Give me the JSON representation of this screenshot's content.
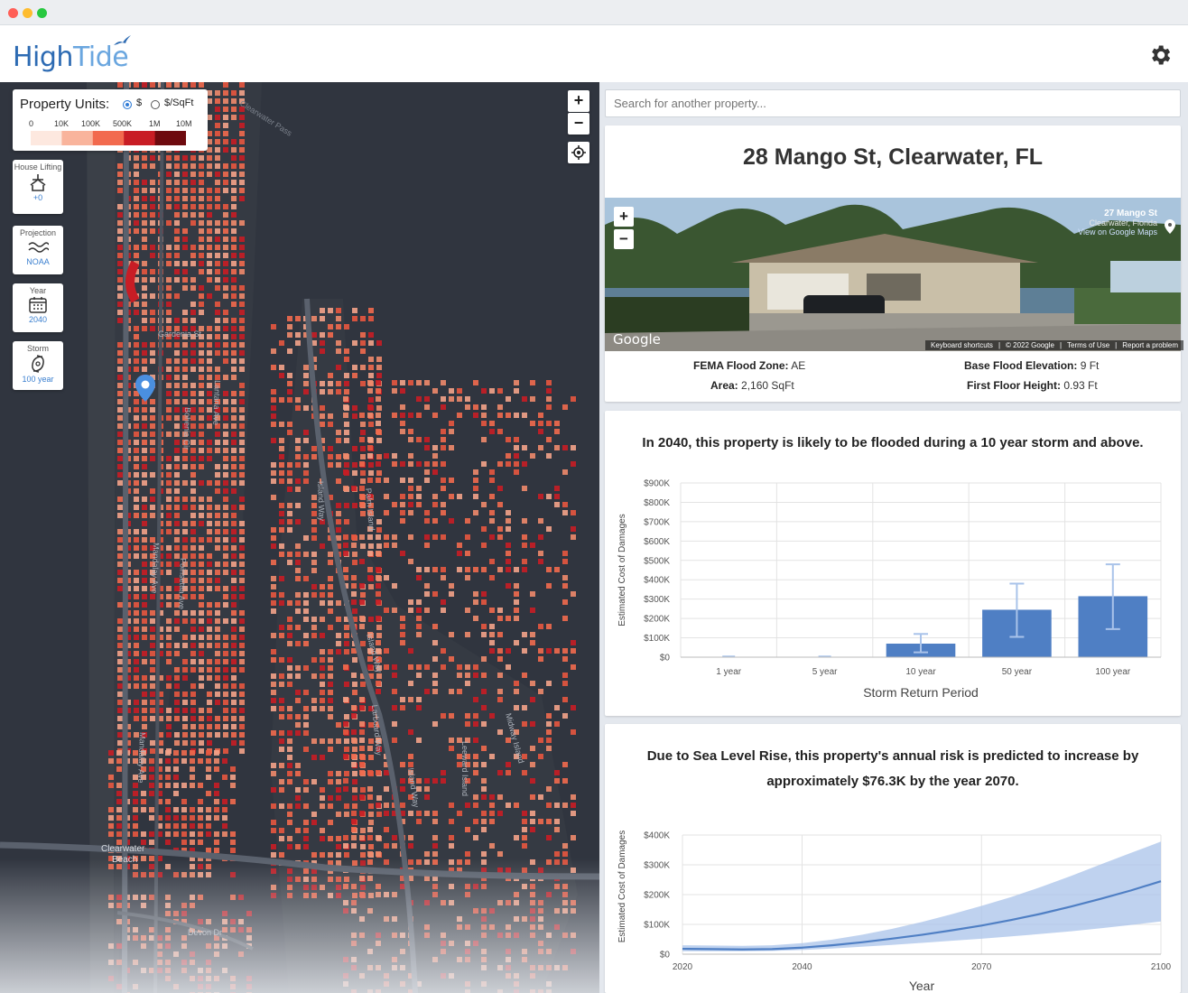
{
  "app": {
    "logo_bold": "High",
    "logo_thin": "Tide"
  },
  "legend": {
    "title": "Property Units:",
    "option_dollar": "$",
    "option_sqft": "$/SqFt",
    "selected": "$",
    "ticks": [
      "0",
      "10K",
      "100K",
      "500K",
      "1M",
      "10M"
    ],
    "colors": [
      "#fde8df",
      "#f9b49c",
      "#f26a4e",
      "#c81d25",
      "#6e0a0f"
    ]
  },
  "tools": [
    {
      "label": "House Lifting",
      "value": "+0",
      "icon": "house-lift-icon"
    },
    {
      "label": "Projection",
      "value": "NOAA",
      "icon": "waves-icon"
    },
    {
      "label": "Year",
      "value": "2040",
      "icon": "calendar-icon"
    },
    {
      "label": "Storm",
      "value": "100 year",
      "icon": "hurricane-icon"
    }
  ],
  "map": {
    "zoom_in": "+",
    "zoom_out": "−",
    "labels": {
      "pass": "Clearwater Pass",
      "gardenia": "Gardenia St",
      "island_way_1": "Island Way",
      "island_way_2": "Island Way",
      "island_way_3": "Island Way",
      "mandalay_1": "Mandalay Ave",
      "mandalay_2": "Mandalay Ave",
      "clearwater_beach_1": "Clearwater",
      "clearwater_beach_2": "Beach",
      "devon": "Devon Dr",
      "poinsettia": "Poinsettia Ave",
      "lantana": "Lantana Ave",
      "bohenia": "Bohenia Cir",
      "larboard": "Larboard Way",
      "leeward": "Leeward Island",
      "midway": "Midway Island",
      "palm": "Palm Island"
    },
    "building_colors": [
      "#f26a4e",
      "#f08a6c",
      "#e8573f",
      "#f4a38a",
      "#c81d25"
    ]
  },
  "search": {
    "placeholder": "Search for another property..."
  },
  "property": {
    "address": "28 Mango St, Clearwater, FL",
    "street_view": {
      "title": "27 Mango St",
      "subtitle": "Clearwater, Florida",
      "link": "View on Google Maps",
      "brand": "Google",
      "footer": [
        "Keyboard shortcuts",
        "© 2022 Google",
        "Terms of Use",
        "Report a problem"
      ]
    },
    "fema_label": "FEMA Flood Zone:",
    "fema_value": "AE",
    "area_label": "Area:",
    "area_value": "2,160 SqFt",
    "bfe_label": "Base Flood Elevation:",
    "bfe_value": "9 Ft",
    "ffh_label": "First Floor Height:",
    "ffh_value": "0.93 Ft"
  },
  "storm_chart": {
    "headline": "In 2040, this property is likely to be flooded during a 10 year storm and above."
  },
  "slr_chart": {
    "headline_1": "Due to Sea Level Rise, this property's annual risk is predicted to increase by",
    "headline_2": "approximately $76.3K by the year 2070."
  },
  "chart_data": [
    {
      "type": "bar",
      "title": "",
      "xlabel": "Storm Return Period",
      "ylabel": "Estimated Cost of Damages",
      "categories": [
        "1 year",
        "5 year",
        "10 year",
        "50 year",
        "100 year"
      ],
      "values": [
        0,
        0,
        70000,
        245000,
        315000
      ],
      "error_low": [
        0,
        0,
        25000,
        105000,
        145000
      ],
      "error_high": [
        0,
        0,
        120000,
        380000,
        480000
      ],
      "yticks": [
        "$0",
        "$100K",
        "$200K",
        "$300K",
        "$400K",
        "$500K",
        "$600K",
        "$700K",
        "$800K",
        "$900K"
      ],
      "ylim": [
        0,
        900000
      ],
      "color": "#4f7fc4",
      "error_color": "#a9c3ea",
      "grid": true
    },
    {
      "type": "area",
      "title": "",
      "xlabel": "Year",
      "ylabel": "Estimated Cost of Damages",
      "x": [
        2020,
        2025,
        2030,
        2035,
        2040,
        2045,
        2050,
        2055,
        2060,
        2065,
        2070,
        2075,
        2080,
        2085,
        2090,
        2095,
        2100
      ],
      "values": [
        18000,
        17000,
        16000,
        17000,
        22000,
        30000,
        40000,
        52000,
        65000,
        80000,
        96000,
        115000,
        136000,
        160000,
        186000,
        214000,
        245000
      ],
      "lower": [
        10000,
        10000,
        10000,
        11000,
        14000,
        19000,
        25000,
        31000,
        38000,
        45000,
        52000,
        60000,
        68000,
        77000,
        87000,
        98000,
        110000
      ],
      "upper": [
        30000,
        29000,
        28000,
        30000,
        37000,
        49000,
        65000,
        85000,
        108000,
        134000,
        162000,
        192000,
        226000,
        263000,
        302000,
        340000,
        378000
      ],
      "xticks": [
        "2020",
        "2040",
        "2070",
        "2100"
      ],
      "yticks": [
        "$0",
        "$100K",
        "$200K",
        "$300K",
        "$400K"
      ],
      "ylim": [
        0,
        400000
      ],
      "xlim": [
        2020,
        2100
      ],
      "color": "#4f7fc4",
      "band_color": "#a9c3ea",
      "grid": true
    }
  ]
}
